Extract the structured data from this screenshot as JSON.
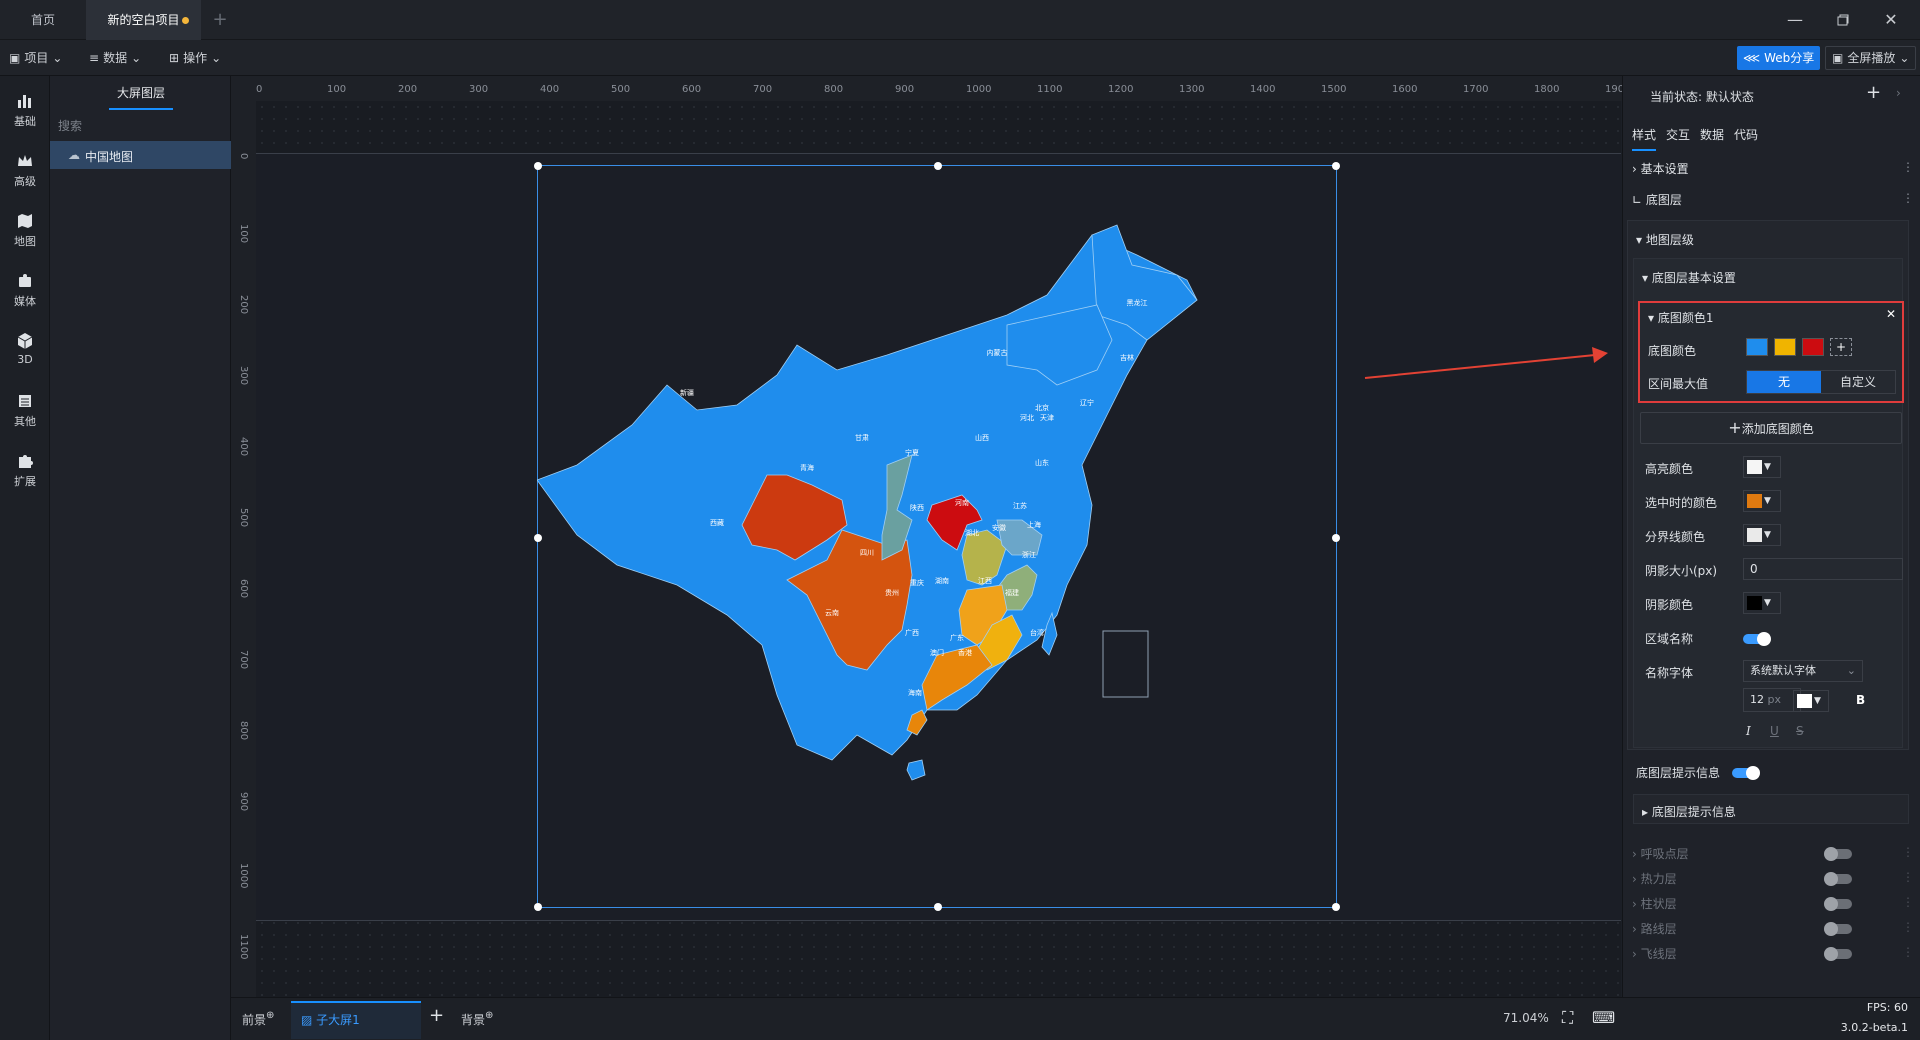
{
  "tabs": {
    "home": "首页",
    "project": "新的空白项目",
    "add": "+"
  },
  "toolbar": {
    "project": "项目",
    "data": "数据",
    "operate": "操作",
    "share": "Web分享",
    "fullscreen": "全屏播放"
  },
  "sidebar": {
    "items": [
      "基础",
      "高级",
      "地图",
      "媒体",
      "3D",
      "其他",
      "扩展"
    ]
  },
  "layers": {
    "title": "大屏图层",
    "search_placeholder": "搜索",
    "item": "中国地图"
  },
  "ruler": {
    "x": [
      "0",
      "100",
      "200",
      "300",
      "400",
      "500",
      "600",
      "700",
      "800",
      "900",
      "1000",
      "1100",
      "1200",
      "1300",
      "1400",
      "1500",
      "1600",
      "1700",
      "1800",
      "1900"
    ],
    "y": [
      "0",
      "100",
      "200",
      "300",
      "400",
      "500",
      "600",
      "700",
      "800",
      "900",
      "1000",
      "1100"
    ]
  },
  "map": {
    "provinces": [
      "黑龙江",
      "吉林",
      "辽宁",
      "内蒙古",
      "北京",
      "天津",
      "河北",
      "山西",
      "山东",
      "宁夏",
      "甘肃",
      "青海",
      "新疆",
      "西藏",
      "四川",
      "重庆",
      "陕西",
      "河南",
      "湖北",
      "安徽",
      "江苏",
      "上海",
      "浙江",
      "江西",
      "福建",
      "湖南",
      "贵州",
      "云南",
      "广西",
      "广东",
      "澳门",
      "香港",
      "海南",
      "台湾"
    ]
  },
  "colors": {
    "base": "#1f8ded",
    "accent": "#1890ff",
    "highlight": "#cc1f1f",
    "orange": "#e8860a",
    "yellow": "#f0b400"
  },
  "right": {
    "state_label": "当前状态:",
    "state_value": "默认状态",
    "tabs": [
      "样式",
      "交互",
      "数据",
      "代码"
    ],
    "basic": "基本设置",
    "base_layer": "底图层",
    "map_level": "地图层级",
    "base_basic": "底图层基本设置",
    "color_group": "底图颜色1",
    "base_color": "底图颜色",
    "range_max": "区间最大值",
    "opt_none": "无",
    "opt_custom": "自定义",
    "add_color": "添加底图颜色",
    "highlight_color": "高亮颜色",
    "selected_color": "选中时的颜色",
    "border_color": "分界线颜色",
    "shadow_size": "阴影大小(px)",
    "shadow_size_val": "0",
    "shadow_color": "阴影颜色",
    "region_name": "区域名称",
    "name_font": "名称字体",
    "font_value": "系统默认字体",
    "font_size": "12",
    "font_unit": "px",
    "tip_label": "底图层提示信息",
    "tip_section": "底图层提示信息",
    "layers": [
      "呼吸点层",
      "热力层",
      "柱状层",
      "路线层",
      "飞线层"
    ]
  },
  "bottom": {
    "front": "前景",
    "sub": "子大屏1",
    "bg": "背景",
    "zoom": "71.04%",
    "fps": "FPS: 60",
    "version": "3.0.2-beta.1"
  }
}
